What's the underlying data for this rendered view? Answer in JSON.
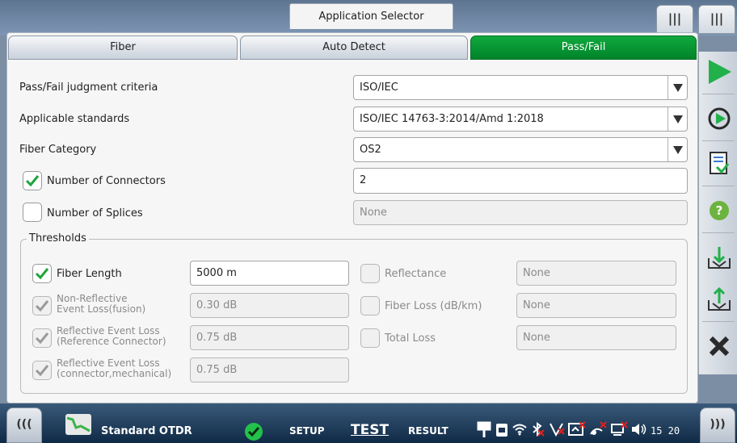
{
  "header": {
    "title": "Application Selector",
    "right_tab1": "|||",
    "right_tab2": "|||"
  },
  "tabs": [
    {
      "label": "Fiber",
      "active": false
    },
    {
      "label": "Auto Detect",
      "active": false
    },
    {
      "label": "Pass/Fail",
      "active": true
    }
  ],
  "settings": {
    "criteria_label": "Pass/Fail judgment criteria",
    "criteria_value": "ISO/IEC",
    "standards_label": "Applicable standards",
    "standards_value": "ISO/IEC 14763-3:2014/Amd 1:2018",
    "category_label": "Fiber Category",
    "category_value": "OS2",
    "connectors_label": "Number of Connectors",
    "connectors_checked": true,
    "connectors_value": "2",
    "splices_label": "Number of Splices",
    "splices_checked": false,
    "splices_value": "None"
  },
  "thresholds": {
    "title": "Thresholds",
    "fiber_length": {
      "label": "Fiber Length",
      "checked": true,
      "value": "5000 m"
    },
    "nonrefl": {
      "label1": "Non-Reflective",
      "label2": "Event Loss(fusion)",
      "checked": true,
      "value": "0.30 dB"
    },
    "refl_ref": {
      "label1": "Reflective Event Loss",
      "label2": "(Reference Connector)",
      "checked": true,
      "value": "0.75 dB"
    },
    "refl_conn": {
      "label1": "Reflective Event Loss",
      "label2": "(connector,mechanical)",
      "checked": true,
      "value": "0.75 dB"
    },
    "reflectance": {
      "label": "Reflectance",
      "checked": false,
      "value": "None"
    },
    "fiber_loss": {
      "label": "Fiber Loss (dB/km)",
      "checked": false,
      "value": "None"
    },
    "total_loss": {
      "label": "Total Loss",
      "checked": false,
      "value": "None"
    }
  },
  "statusbar": {
    "left_tab": "(((",
    "right_tab": ")))",
    "mode": "Standard OTDR",
    "setup": "SETUP",
    "test": "TEST",
    "result": "RESULT",
    "clock": "15 20"
  },
  "sidebar_icons": [
    "start-icon",
    "realtime-icon",
    "report-icon",
    "help-icon",
    "load-icon",
    "save-icon",
    "close-icon"
  ],
  "colors": {
    "accent_green": "#00842a",
    "help_green": "#6db33f",
    "close_dark": "#2a2a2a"
  }
}
